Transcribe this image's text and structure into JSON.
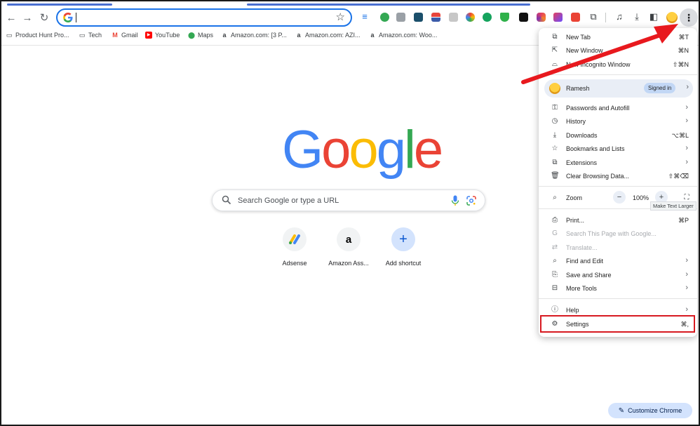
{
  "omnibox": {
    "value": ""
  },
  "bookmarks": [
    {
      "label": "Product Hunt Pro...",
      "icon": "folder-icon"
    },
    {
      "label": "Tech",
      "icon": "folder-icon"
    },
    {
      "label": "Gmail",
      "icon": "gmail-icon"
    },
    {
      "label": "YouTube",
      "icon": "youtube-icon"
    },
    {
      "label": "Maps",
      "icon": "maps-icon"
    },
    {
      "label": "Amazon.com: [3 P...",
      "icon": "amazon-icon"
    },
    {
      "label": "Amazon.com: AZI...",
      "icon": "amazon-icon"
    },
    {
      "label": "Amazon.com: Woo...",
      "icon": "amazon-icon"
    }
  ],
  "page": {
    "logo_letters": [
      {
        "ch": "G",
        "color": "#4285f4"
      },
      {
        "ch": "o",
        "color": "#ea4335"
      },
      {
        "ch": "o",
        "color": "#fbbc05"
      },
      {
        "ch": "g",
        "color": "#4285f4"
      },
      {
        "ch": "l",
        "color": "#34a853"
      },
      {
        "ch": "e",
        "color": "#ea4335"
      }
    ],
    "search_placeholder": "Search Google or type a URL",
    "shortcuts": [
      {
        "label": "Adsense",
        "icon": "adsense-icon"
      },
      {
        "label": "Amazon Ass...",
        "icon": "amazon-icon"
      },
      {
        "label": "Add shortcut",
        "icon": "plus-icon"
      }
    ],
    "customize_label": "Customize Chrome"
  },
  "menu": {
    "new_tab": {
      "label": "New Tab",
      "shortcut": "⌘T"
    },
    "new_window": {
      "label": "New Window",
      "shortcut": "⌘N"
    },
    "new_incognito": {
      "label": "New Incognito Window",
      "shortcut": "⇧⌘N"
    },
    "profile": {
      "name": "Ramesh",
      "badge": "Signed in"
    },
    "passwords": {
      "label": "Passwords and Autofill"
    },
    "history": {
      "label": "History"
    },
    "downloads": {
      "label": "Downloads",
      "shortcut": "⌥⌘L"
    },
    "bookmarks": {
      "label": "Bookmarks and Lists"
    },
    "extensions": {
      "label": "Extensions"
    },
    "clear": {
      "label": "Clear Browsing Data...",
      "shortcut": "⇧⌘⌫"
    },
    "zoom": {
      "label": "Zoom",
      "minus": "−",
      "value": "100%",
      "plus": "+"
    },
    "zoom_tooltip": "Make Text Larger",
    "print": {
      "label": "Print...",
      "shortcut": "⌘P"
    },
    "search_page": {
      "label": "Search This Page with Google..."
    },
    "translate": {
      "label": "Translate..."
    },
    "find_edit": {
      "label": "Find and Edit"
    },
    "save_share": {
      "label": "Save and Share"
    },
    "more_tools": {
      "label": "More Tools"
    },
    "help": {
      "label": "Help"
    },
    "settings": {
      "label": "Settings",
      "shortcut": "⌘,"
    }
  },
  "annotation_color": "#d71920"
}
